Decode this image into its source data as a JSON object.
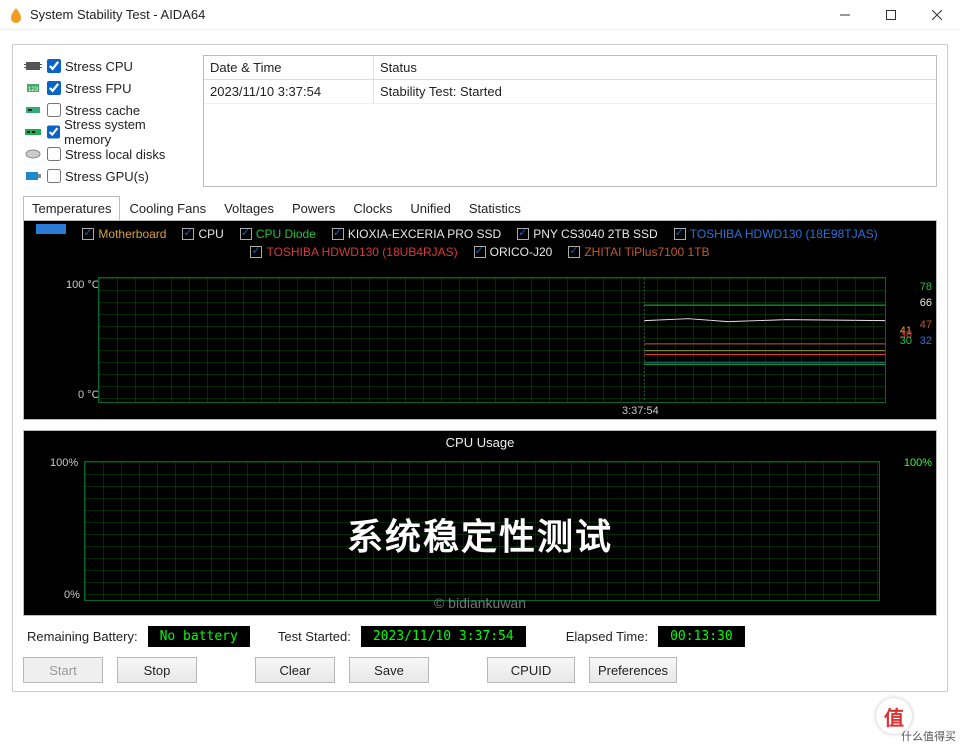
{
  "window": {
    "title": "System Stability Test - AIDA64"
  },
  "stress": {
    "items": [
      {
        "label": "Stress CPU",
        "checked": true
      },
      {
        "label": "Stress FPU",
        "checked": true
      },
      {
        "label": "Stress cache",
        "checked": false
      },
      {
        "label": "Stress system memory",
        "checked": true
      },
      {
        "label": "Stress local disks",
        "checked": false
      },
      {
        "label": "Stress GPU(s)",
        "checked": false
      }
    ]
  },
  "log": {
    "headers": {
      "datetime": "Date & Time",
      "status": "Status"
    },
    "rows": [
      {
        "datetime": "2023/11/10 3:37:54",
        "status": "Stability Test: Started"
      }
    ]
  },
  "tabs": [
    "Temperatures",
    "Cooling Fans",
    "Voltages",
    "Powers",
    "Clocks",
    "Unified",
    "Statistics"
  ],
  "active_tab": 0,
  "temp_chart": {
    "y_top": "100 °C",
    "y_bot": "0 °C",
    "x_tick": "3:37:54",
    "legend": [
      {
        "label": "Motherboard",
        "color": "#d8a23a"
      },
      {
        "label": "CPU",
        "color": "#e8e8e8"
      },
      {
        "label": "CPU Diode",
        "color": "#20c040"
      },
      {
        "label": "KIOXIA-EXCERIA PRO SSD",
        "color": "#e8e8e8"
      },
      {
        "label": "PNY CS3040 2TB SSD",
        "color": "#e8e8e8"
      },
      {
        "label": "TOSHIBA HDWD130 (18E98TJAS)",
        "color": "#2a72d6"
      },
      {
        "label": "TOSHIBA HDWD130 (18UB4RJAS)",
        "color": "#d63a3a"
      },
      {
        "label": "ORICO-J20",
        "color": "#e8e8e8"
      },
      {
        "label": "ZHITAI TiPlus7100 1TB",
        "color": "#c05a2a"
      }
    ],
    "right_labels": [
      {
        "value": "78",
        "color": "#20c040"
      },
      {
        "value": "66",
        "color": "#e8e8e8"
      },
      {
        "value": "47",
        "color": "#c05a2a"
      },
      {
        "value": "41",
        "color": "#d8a23a"
      },
      {
        "value": "38",
        "color": "#d63a3a"
      },
      {
        "value": "30",
        "color": "#20c040"
      },
      {
        "value": "32",
        "color": "#2a72d6"
      }
    ]
  },
  "cpu_chart": {
    "title": "CPU Usage",
    "y_top": "100%",
    "y_bot": "0%",
    "r_top": "100%",
    "overlay": "系统稳定性测试",
    "watermark": "© bidiankuwan"
  },
  "status": {
    "battery_label": "Remaining Battery:",
    "battery_value": "No battery",
    "started_label": "Test Started:",
    "started_value": "2023/11/10 3:37:54",
    "elapsed_label": "Elapsed Time:",
    "elapsed_value": "00:13:30"
  },
  "buttons": {
    "start": "Start",
    "stop": "Stop",
    "clear": "Clear",
    "save": "Save",
    "cpuid": "CPUID",
    "prefs": "Preferences"
  },
  "badge": {
    "symbol": "值",
    "text": "什么值得买"
  },
  "chart_data": [
    {
      "type": "line",
      "title": "Temperatures",
      "ylabel": "°C",
      "ylim": [
        0,
        100
      ],
      "x": [
        "3:37:54"
      ],
      "x_marker": "3:37:54",
      "series": [
        {
          "name": "CPU Diode",
          "current": 78
        },
        {
          "name": "CPU",
          "current": 66
        },
        {
          "name": "ZHITAI TiPlus7100 1TB",
          "current": 47
        },
        {
          "name": "Motherboard",
          "current": 41
        },
        {
          "name": "TOSHIBA HDWD130 (18UB4RJAS)",
          "current": 38
        },
        {
          "name": "TOSHIBA HDWD130 (18E98TJAS)",
          "current": 32
        },
        {
          "name": "ORICO-J20",
          "current": 30
        }
      ]
    },
    {
      "type": "line",
      "title": "CPU Usage",
      "ylabel": "%",
      "ylim": [
        0,
        100
      ],
      "series": [
        {
          "name": "CPU Usage",
          "current": 100
        }
      ]
    }
  ]
}
